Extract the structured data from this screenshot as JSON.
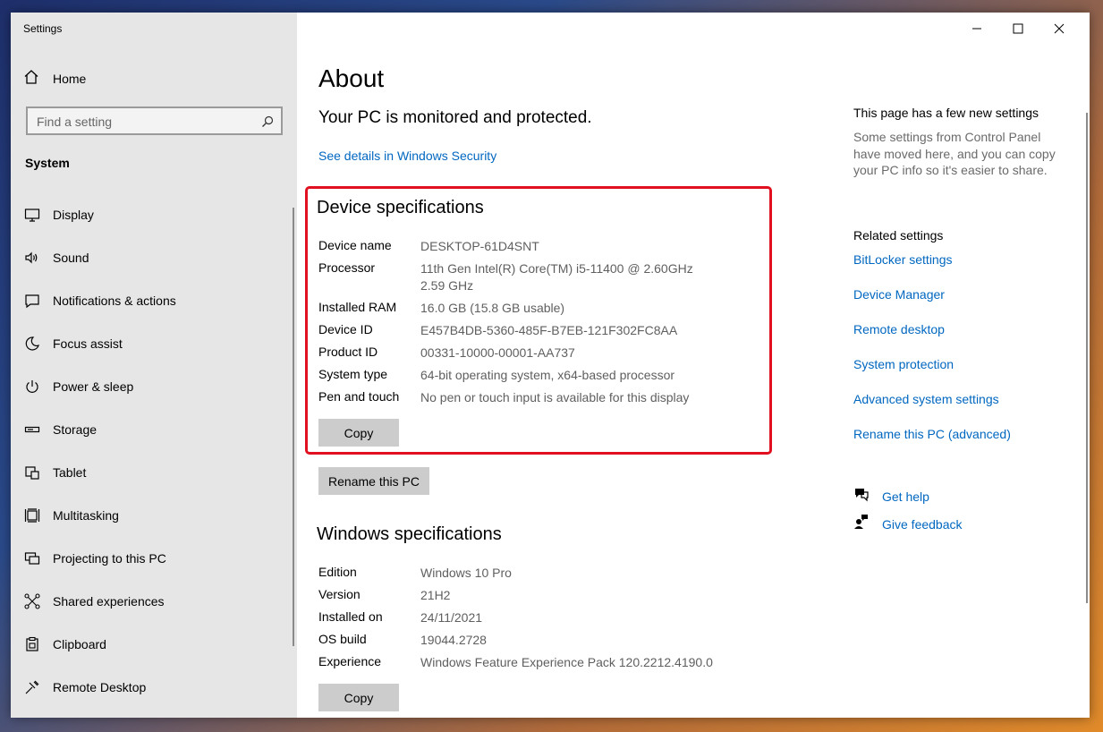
{
  "app": {
    "title": "Settings"
  },
  "sidebar": {
    "home": "Home",
    "search_placeholder": "Find a setting",
    "group": "System",
    "items": [
      {
        "label": "Display",
        "icon": "monitor-icon"
      },
      {
        "label": "Sound",
        "icon": "speaker-icon"
      },
      {
        "label": "Notifications & actions",
        "icon": "notification-icon"
      },
      {
        "label": "Focus assist",
        "icon": "moon-icon"
      },
      {
        "label": "Power & sleep",
        "icon": "power-icon"
      },
      {
        "label": "Storage",
        "icon": "storage-icon"
      },
      {
        "label": "Tablet",
        "icon": "tablet-icon"
      },
      {
        "label": "Multitasking",
        "icon": "multitasking-icon"
      },
      {
        "label": "Projecting to this PC",
        "icon": "projecting-icon"
      },
      {
        "label": "Shared experiences",
        "icon": "shared-icon"
      },
      {
        "label": "Clipboard",
        "icon": "clipboard-icon"
      },
      {
        "label": "Remote Desktop",
        "icon": "remote-desktop-icon"
      }
    ]
  },
  "main": {
    "title": "About",
    "protection": "Your PC is monitored and protected.",
    "security_link": "See details in Windows Security",
    "device_specs": {
      "title": "Device specifications",
      "rows": [
        {
          "key": "Device name",
          "value": "DESKTOP-61D4SNT"
        },
        {
          "key": "Processor",
          "value": "11th Gen Intel(R) Core(TM) i5-11400 @ 2.60GHz   2.59 GHz"
        },
        {
          "key": "Installed RAM",
          "value": "16.0 GB (15.8 GB usable)"
        },
        {
          "key": "Device ID",
          "value": "E457B4DB-5360-485F-B7EB-121F302FC8AA"
        },
        {
          "key": "Product ID",
          "value": "00331-10000-00001-AA737"
        },
        {
          "key": "System type",
          "value": "64-bit operating system, x64-based processor"
        },
        {
          "key": "Pen and touch",
          "value": "No pen or touch input is available for this display"
        }
      ],
      "copy_label": "Copy"
    },
    "rename_label": "Rename this PC",
    "windows_specs": {
      "title": "Windows specifications",
      "rows": [
        {
          "key": "Edition",
          "value": "Windows 10 Pro"
        },
        {
          "key": "Version",
          "value": "21H2"
        },
        {
          "key": "Installed on",
          "value": "24/11/2021"
        },
        {
          "key": "OS build",
          "value": "19044.2728"
        },
        {
          "key": "Experience",
          "value": "Windows Feature Experience Pack 120.2212.4190.0"
        }
      ],
      "copy_label": "Copy"
    }
  },
  "right_panel": {
    "new_title": "This page has a few new settings",
    "new_text": "Some settings from Control Panel have moved here, and you can copy your PC info so it's easier to share.",
    "related_title": "Related settings",
    "links": [
      "BitLocker settings",
      "Device Manager",
      "Remote desktop",
      "System protection",
      "Advanced system settings",
      "Rename this PC (advanced)"
    ],
    "help": "Get help",
    "feedback": "Give feedback"
  },
  "colors": {
    "accent": "#0067c0",
    "highlight": "#e01020",
    "sidebar_bg": "#e6e6e6"
  }
}
